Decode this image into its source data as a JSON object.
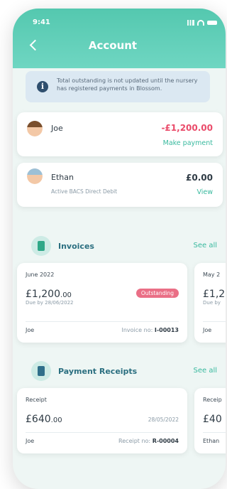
{
  "status": {
    "time": "9:41"
  },
  "header": {
    "title": "Account"
  },
  "notice": {
    "text": "Total outstanding is not updated until the nursery has registered payments in Blossom."
  },
  "children": [
    {
      "name": "Joe",
      "subtitle": "",
      "amount": "-£1,200.00",
      "amount_color": "#ea4b6a",
      "action": "Make payment"
    },
    {
      "name": "Ethan",
      "subtitle": "Active BACS Direct Debit",
      "amount": "£0.00",
      "amount_color": "#2f3b45",
      "action": "View"
    }
  ],
  "invoices": {
    "title": "Invoices",
    "see_all": "See all",
    "cards": [
      {
        "month": "June 2022",
        "currency": "£",
        "amount_main": "1,200",
        "amount_dec": ".00",
        "due": "Due by 28/06/2022",
        "badge": "Outstanding",
        "child": "Joe",
        "invoice_label": "Invoice no:",
        "invoice_no": "I-00013"
      },
      {
        "month": "May 2",
        "currency": "£",
        "amount_main": "1,2",
        "amount_dec": "",
        "due": "Due by",
        "child": "Joe"
      }
    ]
  },
  "receipts": {
    "title": "Payment Receipts",
    "see_all": "See all",
    "cards": [
      {
        "label": "Receipt",
        "currency": "£",
        "amount_main": "640",
        "amount_dec": ".00",
        "date": "28/05/2022",
        "child": "Joe",
        "receipt_label": "Receipt no:",
        "receipt_no": "R-00004"
      },
      {
        "label": "Receip",
        "currency": "£",
        "amount_main": "40",
        "amount_dec": "",
        "child": "Ethan"
      }
    ]
  },
  "icons": [
    "back-chevron-icon",
    "info-icon",
    "invoice-icon",
    "receipt-icon",
    "signal-icon",
    "wifi-icon",
    "battery-icon"
  ]
}
